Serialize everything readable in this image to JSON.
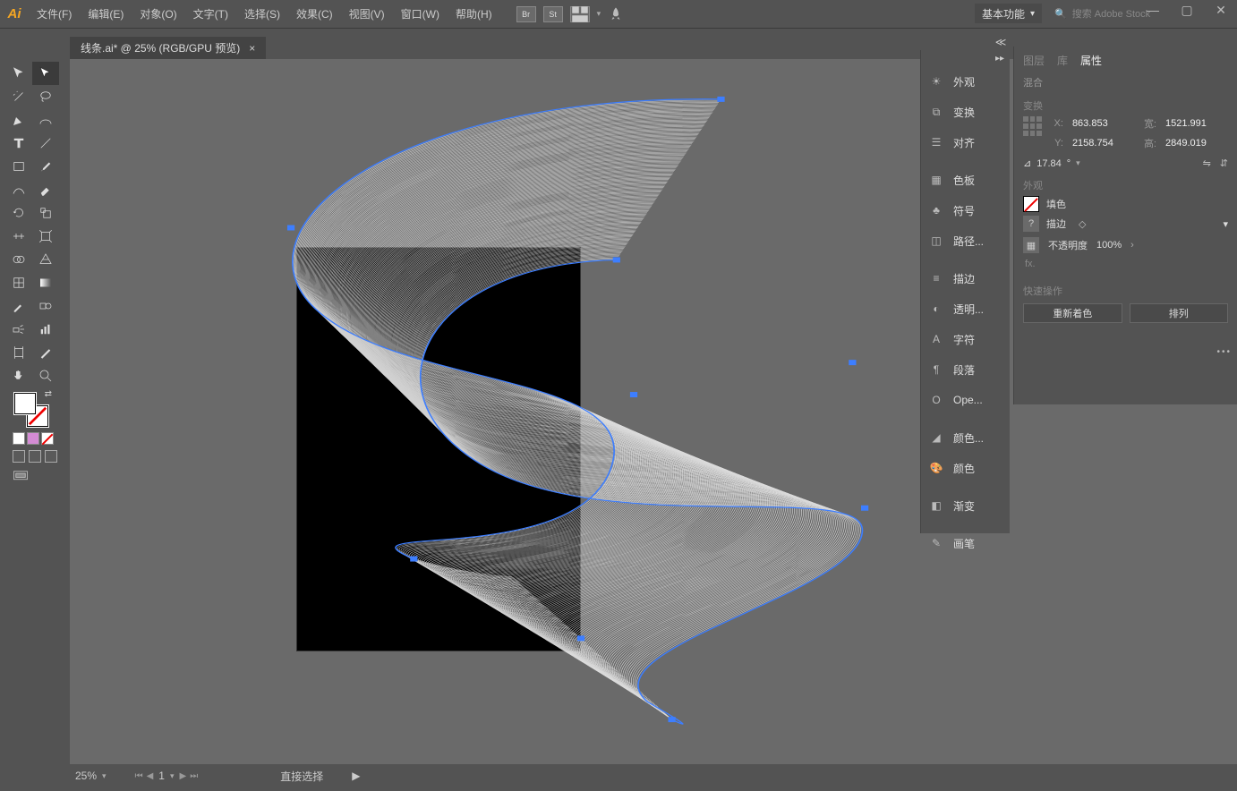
{
  "app": {
    "logo": "Ai"
  },
  "menu": [
    "文件(F)",
    "编辑(E)",
    "对象(O)",
    "文字(T)",
    "选择(S)",
    "效果(C)",
    "视图(V)",
    "窗口(W)",
    "帮助(H)"
  ],
  "control_boxes": [
    "Br",
    "St"
  ],
  "workspace": {
    "label": "基本功能"
  },
  "search_placeholder": "搜索 Adobe Stock",
  "doc_tab": {
    "title": "线条.ai* @ 25% (RGB/GPU 预览)"
  },
  "status": {
    "zoom": "25%",
    "artboard_index": "1",
    "tool": "直接选择"
  },
  "right_icons": [
    {
      "label": "外观"
    },
    {
      "label": "变换"
    },
    {
      "label": "对齐"
    },
    {
      "label": "色板"
    },
    {
      "label": "符号"
    },
    {
      "label": "路径..."
    },
    {
      "label": "描边"
    },
    {
      "label": "透明..."
    },
    {
      "label": "字符"
    },
    {
      "label": "段落"
    },
    {
      "label": "Ope..."
    },
    {
      "label": "颜色..."
    },
    {
      "label": "颜色"
    },
    {
      "label": "渐变"
    },
    {
      "label": "画笔"
    }
  ],
  "prop": {
    "tabs": [
      "图层",
      "库",
      "属性"
    ],
    "active_tab": 2,
    "selection_label": "混合",
    "sec_transform": "变换",
    "x": "863.853",
    "y": "2158.754",
    "w": "1521.991",
    "h": "2849.019",
    "x_lab": "X:",
    "y_lab": "Y:",
    "w_lab": "宽:",
    "h_lab": "高:",
    "angle": "17.84",
    "sec_appearance": "外观",
    "fill_label": "填色",
    "stroke_label": "描边",
    "opacity_label": "不透明度",
    "opacity_value": "100%",
    "fx": "fx.",
    "quick_title": "快速操作",
    "btn_recolor": "重新着色",
    "btn_arrange": "排列"
  }
}
